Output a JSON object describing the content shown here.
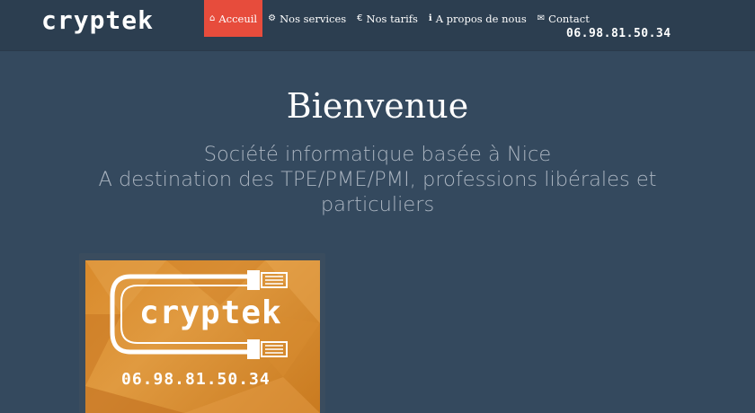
{
  "brand": "cryptek",
  "nav": {
    "items": [
      {
        "label": "Acceuil",
        "icon": "home-icon",
        "glyph": "⌂",
        "active": true
      },
      {
        "label": "Nos services",
        "icon": "cogs-icon",
        "glyph": "⚙",
        "active": false
      },
      {
        "label": "Nos tarifs",
        "icon": "euro-icon",
        "glyph": "€",
        "active": false
      },
      {
        "label": "A propos de nous",
        "icon": "info-icon",
        "glyph": "ℹ",
        "active": false
      },
      {
        "label": "Contact",
        "icon": "envelope-icon",
        "glyph": "✉",
        "active": false
      }
    ]
  },
  "phone": "06.98.81.50.34",
  "hero": {
    "title": "Bienvenue",
    "subtitle_line1": "Société informatique basée à Nice",
    "subtitle_line2": "A destination des TPE/PME/PMI, professions libérales et particuliers"
  },
  "logo": {
    "word": "cryptek",
    "phone": "06.98.81.50.34"
  },
  "colors": {
    "background": "#34495e",
    "navbar": "#2c3e50",
    "active": "#e74c3c",
    "logo_orange": "#d98a2b"
  }
}
